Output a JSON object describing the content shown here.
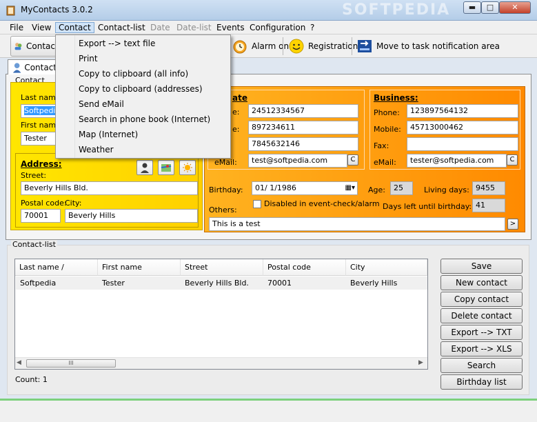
{
  "window": {
    "title": "MyContacts 3.0.2",
    "watermark": "SOFTPEDIA",
    "minimize_glyph": "▬",
    "maximize_glyph": "□",
    "close_glyph": "✕"
  },
  "menubar": [
    {
      "label": "File",
      "state": "normal"
    },
    {
      "label": "View",
      "state": "normal"
    },
    {
      "label": "Contact",
      "state": "active"
    },
    {
      "label": "Contact-list",
      "state": "normal"
    },
    {
      "label": "Date",
      "state": "disabled"
    },
    {
      "label": "Date-list",
      "state": "disabled"
    },
    {
      "label": "Events",
      "state": "normal"
    },
    {
      "label": "Configuration",
      "state": "normal"
    },
    {
      "label": "?",
      "state": "normal"
    }
  ],
  "toolbar": {
    "contact_label": "Contac",
    "alarm_label": "Alarm on",
    "registration_label": "Registration",
    "tray_label": "Move to task notification area"
  },
  "dropdown_items": [
    "Export --> text file",
    "Print",
    "Copy to clipboard (all info)",
    "Copy to clipboard (addresses)",
    "Send eMail",
    "Search in phone book (Internet)",
    "Map (Internet)",
    "Weather"
  ],
  "tab": {
    "label": "Contact"
  },
  "contact_group": {
    "legend": "Contact",
    "last_name_label": "Last name",
    "last_name_value": "Softpedia",
    "first_name_label": "First name",
    "first_name_value": "Tester"
  },
  "address": {
    "title": "Address:",
    "street_label": "Street:",
    "street_value": "Beverly Hills Bld.",
    "postal_label": "Postal code:",
    "postal_value": "70001",
    "city_label": "City:",
    "city_value": "Beverly Hills"
  },
  "private": {
    "title": "ate",
    "phone_label": "e:",
    "phone_value": "24512334567",
    "mobile_label": "e:",
    "mobile_value": "897234611",
    "fax_value": "7845632146",
    "email_label": "eMail:",
    "email_value": "test@softpedia.com",
    "c_button": "C"
  },
  "business": {
    "title": "Business:",
    "phone_label": "Phone:",
    "phone_value": "123897564132",
    "mobile_label": "Mobile:",
    "mobile_value": "45713000462",
    "fax_label": "Fax:",
    "fax_value": "",
    "email_label": "eMail:",
    "email_value": "tester@softpedia.com",
    "c_button": "C"
  },
  "birthday": {
    "label": "Birthday:",
    "value": "01/  1/1986",
    "age_label": "Age:",
    "age_value": "25",
    "living_days_label": "Living days:",
    "living_days_value": "9455",
    "disabled_label": "Disabled in event-check/alarm",
    "days_left_label": "Days left until birthday:",
    "days_left_value": "41"
  },
  "others": {
    "label": "Others:",
    "value": "This is a test",
    "go_button": ">"
  },
  "contact_list": {
    "legend": "Contact-list",
    "columns": [
      "Last name / company",
      "First name",
      "Street",
      "Postal code",
      "City"
    ],
    "rows": [
      [
        "Softpedia",
        "Tester",
        "Beverly Hills Bld.",
        "70001",
        "Beverly Hills"
      ]
    ],
    "scroll_left": "◀",
    "scroll_right": "▶",
    "scroll_thumb": "III",
    "count_label": "Count: 1"
  },
  "side_buttons": [
    "Save",
    "New contact",
    "Copy contact",
    "Delete contact",
    "Export --> TXT",
    "Export --> XLS",
    "Search",
    "Birthday list"
  ],
  "colors": {
    "yellow_panel": "#ffe600",
    "orange_panel": "#ff9a00",
    "selection": "#3399ff",
    "status_green": "#7cd07c"
  },
  "icons": {
    "app": "address-book-icon",
    "tab": "person-icon",
    "toolbar_contact": "contacts-icon",
    "alarm": "alarm-clock-icon",
    "registration": "smiley-icon",
    "tray": "tray-icon"
  }
}
